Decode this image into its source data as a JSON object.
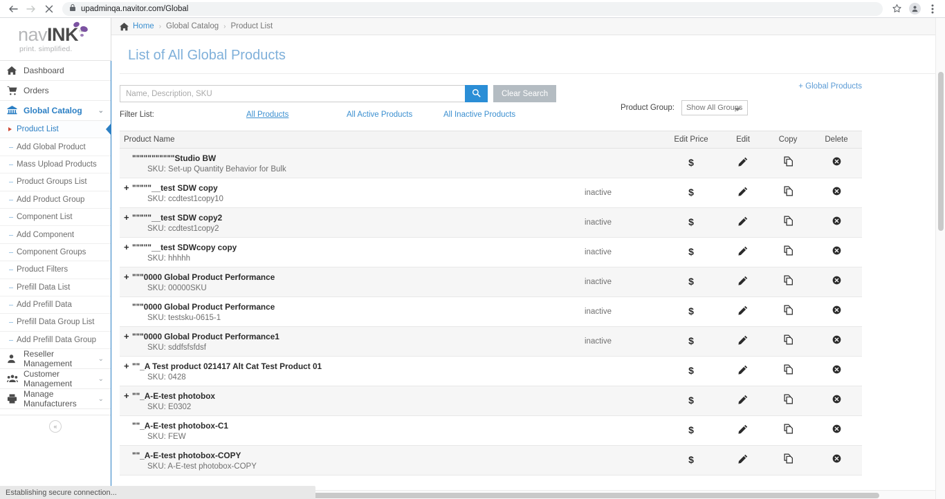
{
  "browser": {
    "url": "upadminqa.navitor.com/Global",
    "back_tooltip": "Back",
    "forward_tooltip": "Forward",
    "stop_tooltip": "Stop",
    "bookmark_tooltip": "Bookmark this tab",
    "profile_tooltip": "Profile",
    "menu_tooltip": "Customize and control"
  },
  "logo": {
    "nav": "nav",
    "ink": "INK",
    "tm": "™",
    "tagline": "print. simplified."
  },
  "sidebar": {
    "items": [
      {
        "label": "Dashboard",
        "icon": "home-icon"
      },
      {
        "label": "Orders",
        "icon": "cart-icon"
      },
      {
        "label": "Global Catalog",
        "icon": "bank-icon",
        "chevron": "⌄",
        "active": true
      }
    ],
    "sub_items": [
      {
        "label": "Product List",
        "selected": true
      },
      {
        "label": "Add Global Product"
      },
      {
        "label": "Mass Upload Products"
      },
      {
        "label": "Product Groups List"
      },
      {
        "label": "Add Product Group"
      },
      {
        "label": "Component List"
      },
      {
        "label": "Add Component"
      },
      {
        "label": "Component Groups"
      },
      {
        "label": "Product Filters"
      },
      {
        "label": "Prefill Data List"
      },
      {
        "label": "Add Prefill Data"
      },
      {
        "label": "Prefill Data Group List"
      },
      {
        "label": "Add Prefill Data Group"
      }
    ],
    "bottom_items": [
      {
        "label": "Reseller Management",
        "icon": "user-icon",
        "chevron": "⌄"
      },
      {
        "label": "Customer Management",
        "icon": "users-icon",
        "chevron": "⌄"
      },
      {
        "label": "Manage Manufacturers",
        "icon": "printer-icon",
        "chevron": "⌄"
      }
    ],
    "collapse_label": "«"
  },
  "breadcrumb": {
    "home": "Home",
    "level2": "Global Catalog",
    "level3": "Product List",
    "separator": "›"
  },
  "page": {
    "title": "List of All Global Products"
  },
  "search": {
    "placeholder": "Name, Description, SKU",
    "value": "",
    "search_icon": "search-icon",
    "clear_label": "Clear Search"
  },
  "filters": {
    "label": "Filter List:",
    "all_products": "All Products",
    "all_active": "All Active Products",
    "all_inactive": "All Inactive Products"
  },
  "right_tools": {
    "add_global_products": "+ Global Products",
    "product_group_label": "Product Group:",
    "product_group_value": "Show All Groups",
    "product_group_options": [
      "Show All Groups"
    ]
  },
  "table": {
    "headers": {
      "name": "Product Name",
      "edit_price": "Edit Price",
      "edit": "Edit",
      "copy": "Copy",
      "delete": "Delete"
    },
    "icons": {
      "price": "$",
      "edit": "pencil-icon",
      "copy": "copy-icon",
      "delete": "delete-circle-icon",
      "expand": "+"
    },
    "rows": [
      {
        "expandable": false,
        "name": "\"\"\"\"\"\"\"\"\"\"\"Studio BW",
        "sku": "SKU: Set-up Quantity Behavior for Bulk",
        "status": ""
      },
      {
        "expandable": true,
        "name": "\"\"\"\"\"__test SDW copy",
        "sku": "SKU: ccdtest1copy10",
        "status": "inactive"
      },
      {
        "expandable": true,
        "name": "\"\"\"\"\"__test SDW copy2",
        "sku": "SKU: ccdtest1copy2",
        "status": "inactive"
      },
      {
        "expandable": true,
        "name": "\"\"\"\"\"__test SDWcopy copy",
        "sku": "SKU: hhhhh",
        "status": "inactive"
      },
      {
        "expandable": true,
        "name": "\"\"\"0000 Global Product Performance",
        "sku": "SKU: 00000SKU",
        "status": "inactive"
      },
      {
        "expandable": false,
        "name": "\"\"\"0000 Global Product Performance",
        "sku": "SKU: testsku-0615-1",
        "status": "inactive"
      },
      {
        "expandable": true,
        "name": "\"\"\"0000 Global Product Performance1",
        "sku": "SKU: sddfsfsfdsf",
        "status": "inactive"
      },
      {
        "expandable": true,
        "name": "\"\"_A Test product 021417 Alt Cat Test Product 01",
        "sku": "SKU: 0428",
        "status": ""
      },
      {
        "expandable": true,
        "name": "\"\"_A-E-test photobox",
        "sku": "SKU: E0302",
        "status": ""
      },
      {
        "expandable": false,
        "name": "\"\"_A-E-test photobox-C1",
        "sku": "SKU: FEW",
        "status": ""
      },
      {
        "expandable": false,
        "name": "\"\"_A-E-test photobox-COPY",
        "sku": "SKU: A-E-test photobox-COPY",
        "status": ""
      }
    ]
  },
  "status_bar": {
    "message": "Establishing secure connection..."
  },
  "colors": {
    "accent_blue": "#2b8ed6",
    "link_blue": "#3b8fd0",
    "title_blue": "#7fb0da",
    "logo_purple": "#7b52a1",
    "marker_red": "#cf4a36"
  }
}
